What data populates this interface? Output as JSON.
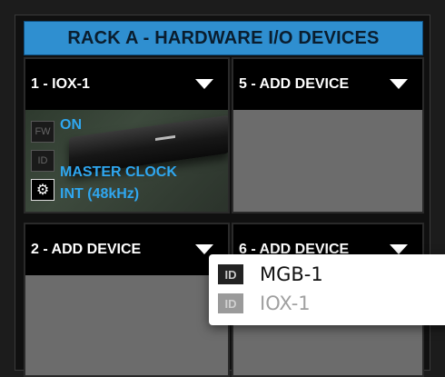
{
  "rack": {
    "title": "RACK A - HARDWARE I/O DEVICES"
  },
  "slots": [
    {
      "label": "1 - IOX-1",
      "device": {
        "fw_label": "FW",
        "id_label": "ID",
        "settings_icon": "gear-icon",
        "status": "ON",
        "clock_line1": "MASTER CLOCK",
        "clock_line2": "INT (48kHz)"
      }
    },
    {
      "label": "5 - ADD DEVICE"
    },
    {
      "label": "2 - ADD DEVICE"
    },
    {
      "label": "6 - ADD DEVICE"
    }
  ],
  "dropdown": {
    "items": [
      {
        "badge": "ID",
        "label": "MGB-1",
        "enabled": true
      },
      {
        "badge": "ID",
        "label": "IOX-1",
        "enabled": false
      }
    ]
  },
  "colors": {
    "accent": "#2f8fd0",
    "status_text": "#2fa7f0"
  }
}
